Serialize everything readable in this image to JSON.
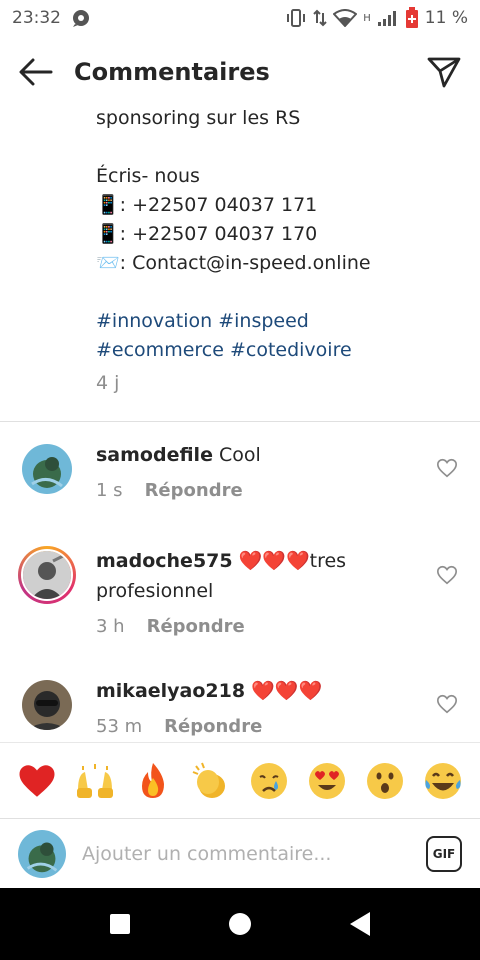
{
  "status_bar": {
    "time": "23:32",
    "network_label": "H",
    "battery": "11 %"
  },
  "header": {
    "title": "Commentaires"
  },
  "caption": {
    "lines": [
      "sponsoring sur les RS",
      "",
      "Écris- nous",
      "📱: +22507 04037 171",
      "📱: +22507 04037 170",
      "📨: Contact@in-speed.online",
      ""
    ],
    "hashtags_line1": "#innovation #inspeed",
    "hashtags_line2": "#ecommerce #cotedivoire",
    "age": "4 j"
  },
  "comments": [
    {
      "username": "samodefile",
      "text": " Cool",
      "time": "1 s",
      "reply_label": "Répondre"
    },
    {
      "username": "madoche575",
      "text": " ❤️❤️❤️tres profesionnel",
      "time": "3 h",
      "reply_label": "Répondre"
    },
    {
      "username": "mikaelyao218",
      "text": " ❤️❤️❤️",
      "time": "53 m",
      "reply_label": "Répondre"
    }
  ],
  "reactions": [
    "❤️",
    "🙌",
    "🔥",
    "👏",
    "😢",
    "😍",
    "😮",
    "😂"
  ],
  "input": {
    "placeholder": "Ajouter un commentaire...",
    "gif_label": "GIF"
  },
  "colors": {
    "hashtag": "#1e4a7a",
    "muted": "#8e8e8e",
    "text": "#262626"
  }
}
